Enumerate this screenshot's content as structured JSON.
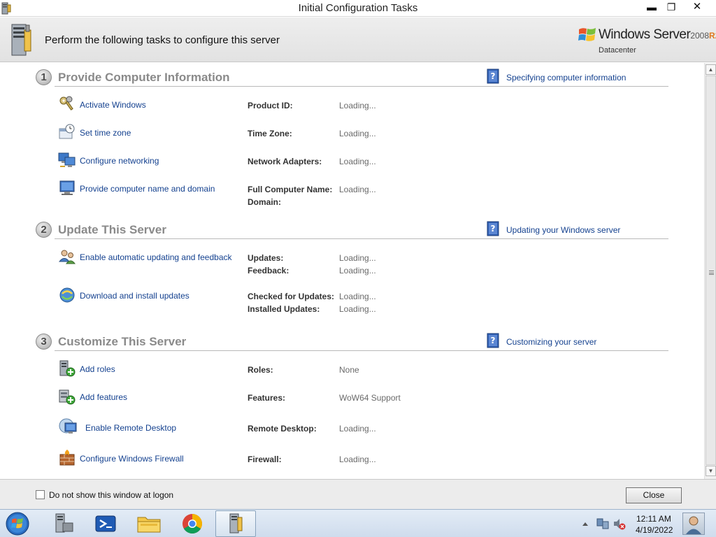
{
  "window": {
    "title": "Initial Configuration Tasks",
    "minimize_label": "▬",
    "maximize_label": "❐",
    "close_label": "✕"
  },
  "header": {
    "heading": "Perform the following tasks to configure this server",
    "brand": {
      "product": "Windows Server",
      "year": "2008",
      "release": "R2",
      "edition": "Datacenter"
    }
  },
  "sections": [
    {
      "number": "1",
      "title": "Provide Computer Information",
      "help": "Specifying computer information",
      "tasks": [
        {
          "icon": "keys-icon",
          "label": "Activate Windows",
          "props": [
            {
              "label": "Product ID:",
              "value": "Loading..."
            }
          ]
        },
        {
          "icon": "clock-icon",
          "label": "Set time zone",
          "props": [
            {
              "label": "Time Zone:",
              "value": "Loading..."
            }
          ]
        },
        {
          "icon": "network-icon",
          "label": "Configure networking",
          "props": [
            {
              "label": "Network Adapters:",
              "value": "Loading..."
            }
          ]
        },
        {
          "icon": "computer-icon",
          "label": "Provide computer name and domain",
          "props": [
            {
              "label": "Full Computer Name:",
              "value": "Loading..."
            },
            {
              "label": "Domain:",
              "value": ""
            }
          ]
        }
      ]
    },
    {
      "number": "2",
      "title": "Update This Server",
      "help": "Updating your Windows server",
      "tasks": [
        {
          "icon": "users-icon",
          "label": "Enable automatic updating and feedback",
          "props": [
            {
              "label": "Updates:",
              "value": "Loading..."
            },
            {
              "label": "Feedback:",
              "value": "Loading..."
            }
          ]
        },
        {
          "icon": "update-icon",
          "label": "Download and install updates",
          "props": [
            {
              "label": "Checked for Updates:",
              "value": "Loading..."
            },
            {
              "label": "Installed Updates:",
              "value": "Loading..."
            }
          ]
        }
      ]
    },
    {
      "number": "3",
      "title": "Customize This Server",
      "help": "Customizing your server",
      "tasks": [
        {
          "icon": "add-roles-icon",
          "label": "Add roles",
          "props": [
            {
              "label": "Roles:",
              "value": "None"
            }
          ]
        },
        {
          "icon": "add-features-icon",
          "label": "Add features",
          "props": [
            {
              "label": "Features:",
              "value": "WoW64 Support"
            }
          ]
        },
        {
          "icon": "remote-desktop-icon",
          "label": "Enable Remote Desktop",
          "props": [
            {
              "label": "Remote Desktop:",
              "value": "Loading..."
            }
          ]
        },
        {
          "icon": "firewall-icon",
          "label": "Configure Windows Firewall",
          "props": [
            {
              "label": "Firewall:",
              "value": "Loading..."
            }
          ]
        }
      ]
    }
  ],
  "footer": {
    "checkbox_label": "Do not show this window at logon",
    "checkbox_checked": false,
    "close_button": "Close"
  },
  "taskbar": {
    "items": [
      "server-manager-icon",
      "powershell-icon",
      "file-explorer-icon",
      "chrome-icon",
      "config-tasks-icon"
    ],
    "active_item": "config-tasks-icon",
    "clock": {
      "time": "12:11 AM",
      "date": "4/19/2022"
    }
  },
  "colors": {
    "link": "#14418f",
    "section_title": "#8a8a8a",
    "taskbar": "#d7e3f0"
  }
}
